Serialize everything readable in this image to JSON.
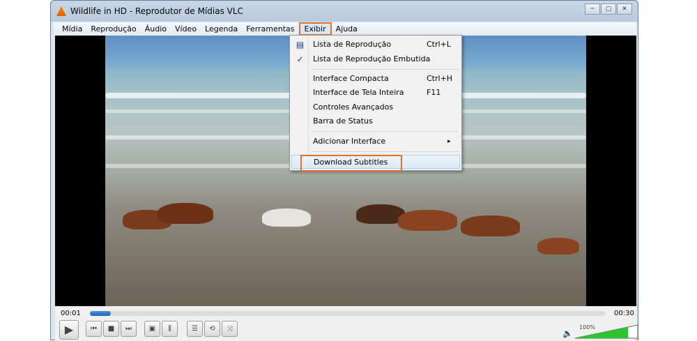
{
  "window": {
    "title": "Wildlife in HD - Reprodutor de Mídias VLC",
    "buttons": [
      "─",
      "▢",
      "✕"
    ]
  },
  "menubar": [
    "Mídia",
    "Reprodução",
    "Áudio",
    "Vídeo",
    "Legenda",
    "Ferramentas",
    "Exibir",
    "Ajuda"
  ],
  "menu": {
    "items": [
      {
        "label": "Lista de Reprodução",
        "shortcut": "Ctrl+L"
      },
      {
        "label": "Lista de Reprodução Embutida",
        "shortcut": ""
      },
      {
        "label": "Interface Compacta",
        "shortcut": "Ctrl+H"
      },
      {
        "label": "Interface de Tela Inteira",
        "shortcut": "F11"
      },
      {
        "label": "Controles Avançados",
        "shortcut": ""
      },
      {
        "label": "Barra de Status",
        "shortcut": ""
      },
      {
        "label": "Adicionar Interface",
        "shortcut": "▸"
      },
      {
        "label": "Download Subtitles",
        "shortcut": ""
      }
    ]
  },
  "controls": {
    "elapsed": "00:01",
    "total": "00:30",
    "progress_percent": 4,
    "volume_label": "100%",
    "volume_percent": 100
  }
}
